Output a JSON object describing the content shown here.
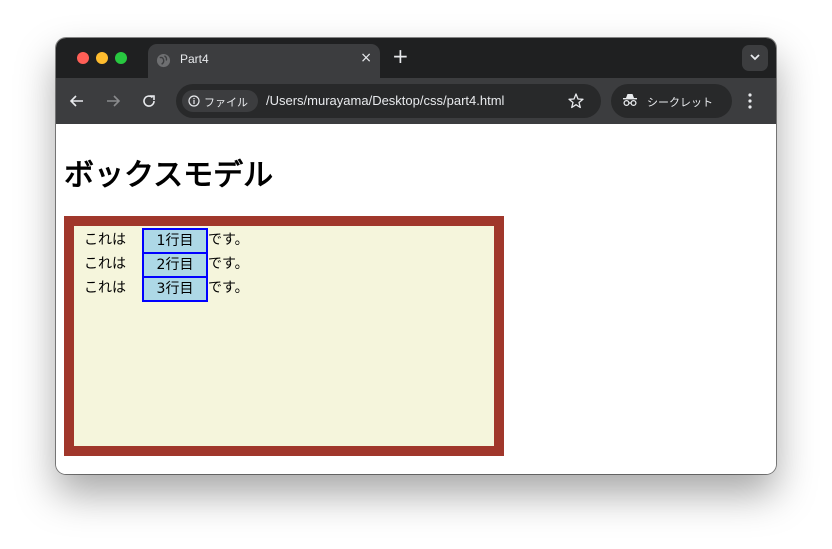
{
  "browser": {
    "tab_title": "Part4",
    "tab_close": "×",
    "new_tab": "+",
    "security_chip": "ファイル",
    "url": "/Users/murayama/Desktop/css/part4.html",
    "incognito_label": "シークレット"
  },
  "page": {
    "title": "ボックスモデル",
    "rows": [
      {
        "pre": "これは",
        "mid": "1行目",
        "post": "です。"
      },
      {
        "pre": "これは",
        "mid": "2行目",
        "post": "です。"
      },
      {
        "pre": "これは",
        "mid": "3行目",
        "post": "です。"
      }
    ]
  },
  "colors": {
    "outer_border": "#a0372b",
    "outer_background": "#f5f5dc",
    "inner_background": "#add8e6",
    "inner_border": "#0000ff"
  }
}
